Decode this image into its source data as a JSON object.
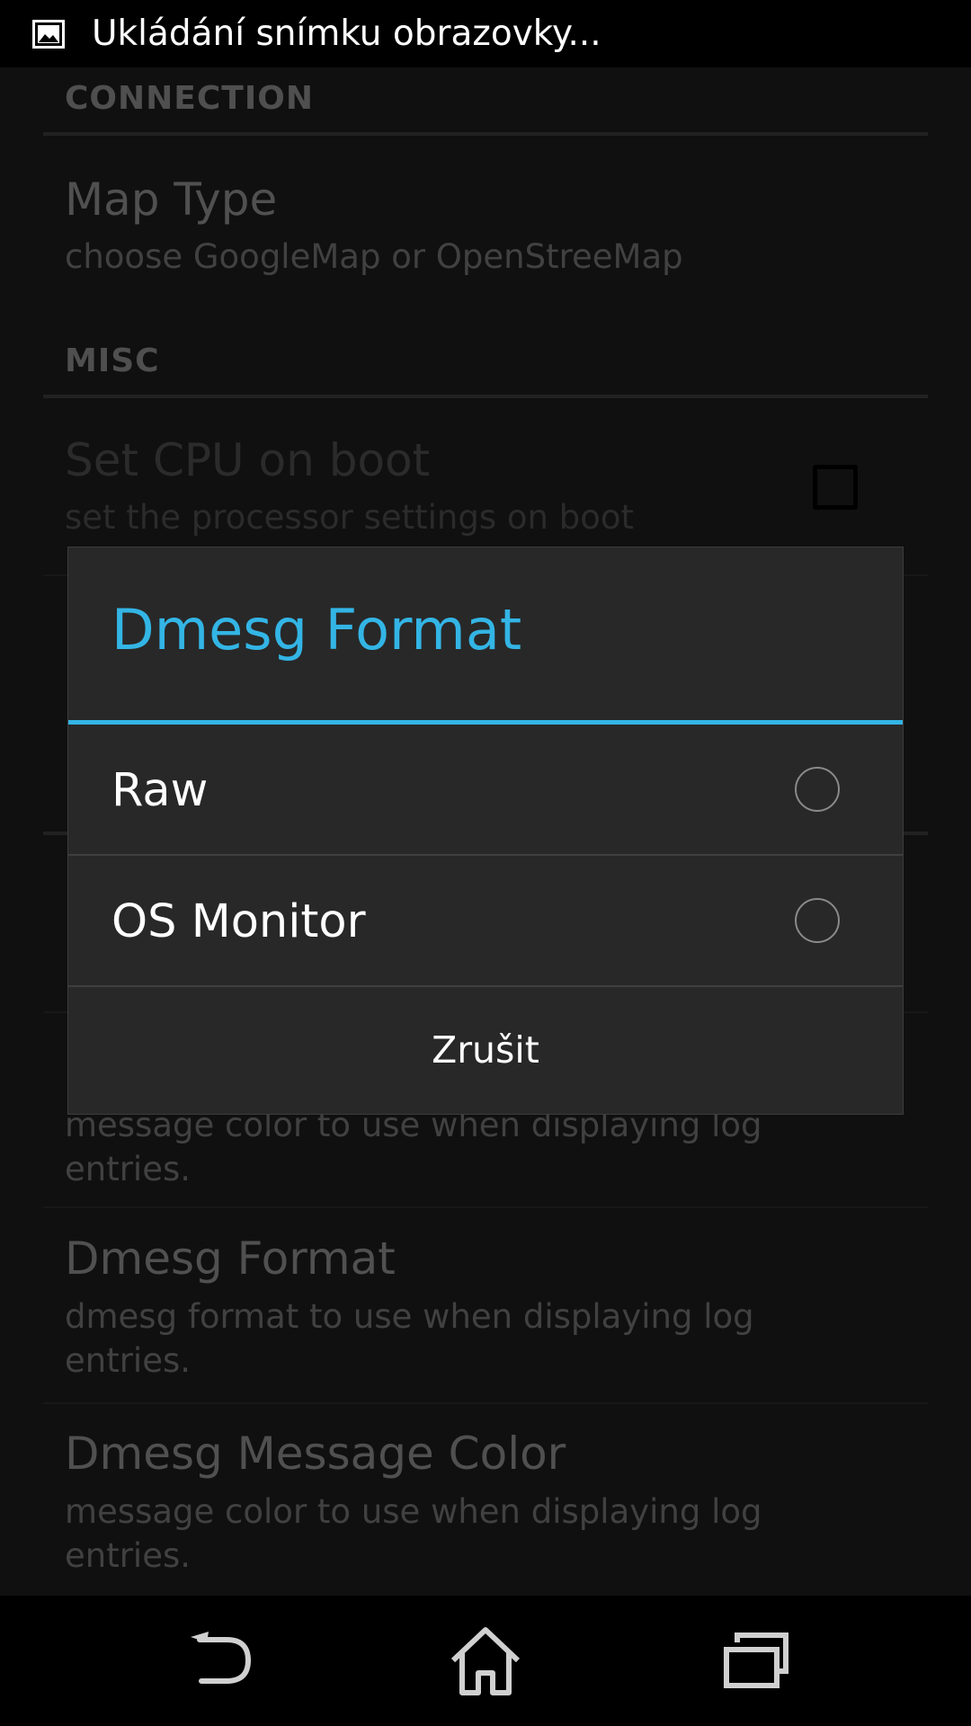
{
  "status_bar": {
    "notification_text": "Ukládání snímku obrazovky...",
    "icon": "image-icon"
  },
  "settings": {
    "categories": [
      "CONNECTION",
      "MISC"
    ],
    "items": [
      {
        "title": "Map Type",
        "summary": "choose GoogleMap or OpenStreeMap"
      },
      {
        "title": "Set CPU on boot",
        "summary": "set the processor settings on boot",
        "checked": false
      },
      {
        "title": "",
        "summary": "message color to use when displaying log entries."
      },
      {
        "title": "Dmesg Format",
        "summary": "dmesg format to use when displaying log entries."
      },
      {
        "title": "Dmesg Message Color",
        "summary": "message color to use when displaying log entries."
      }
    ]
  },
  "dialog": {
    "title": "Dmesg Format",
    "options": [
      {
        "label": "Raw",
        "selected": false
      },
      {
        "label": "OS Monitor",
        "selected": false
      }
    ],
    "cancel_label": "Zrušit"
  },
  "nav_bar": {
    "buttons": [
      "back-icon",
      "home-icon",
      "recent-apps-icon"
    ]
  },
  "colors": {
    "accent": "#33b5e5",
    "dialog_bg": "#282828",
    "background": "#1c1c1c"
  }
}
